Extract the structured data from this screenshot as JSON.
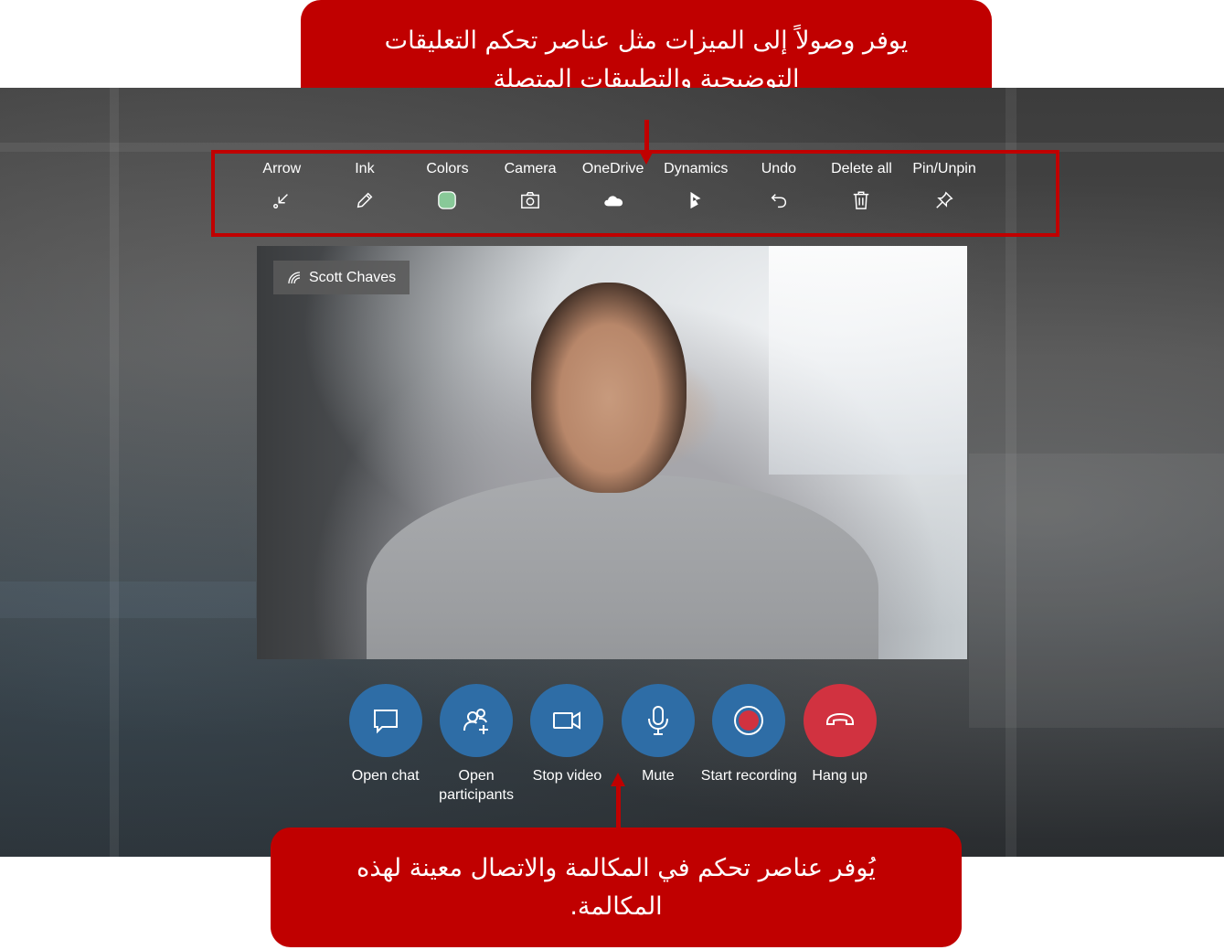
{
  "colors": {
    "annotation_red": "#c00000",
    "button_blue": "#2e6da6",
    "hangup_red": "#d13240",
    "color_swatch": "#88c998"
  },
  "callouts": {
    "top": "يوفر وصولاً إلى الميزات مثل عناصر تحكم التعليقات التوضيحية والتطبيقات المتصلة",
    "bottom": "يُوفر عناصر تحكم في المكالمة والاتصال معينة لهذه المكالمة."
  },
  "toolbar": {
    "items": [
      {
        "label": "Arrow",
        "icon": "arrow-icon"
      },
      {
        "label": "Ink",
        "icon": "pen-icon"
      },
      {
        "label": "Colors",
        "icon": "color-swatch-icon"
      },
      {
        "label": "Camera",
        "icon": "camera-icon"
      },
      {
        "label": "OneDrive",
        "icon": "cloud-icon"
      },
      {
        "label": "Dynamics",
        "icon": "dynamics-icon"
      },
      {
        "label": "Undo",
        "icon": "undo-icon"
      },
      {
        "label": "Delete all",
        "icon": "trash-icon"
      },
      {
        "label": "Pin/Unpin",
        "icon": "pin-icon"
      }
    ]
  },
  "video": {
    "participant_name": "Scott Chaves",
    "name_icon": "signal-icon"
  },
  "controls": {
    "items": [
      {
        "label": "Open chat",
        "icon": "chat-icon"
      },
      {
        "label": "Open\nparticipants",
        "icon": "participants-add-icon"
      },
      {
        "label": "Stop video",
        "icon": "video-camera-icon"
      },
      {
        "label": "Mute",
        "icon": "microphone-icon"
      },
      {
        "label": "Start recording",
        "icon": "record-icon"
      },
      {
        "label": "Hang up",
        "icon": "hang-up-icon"
      }
    ]
  }
}
